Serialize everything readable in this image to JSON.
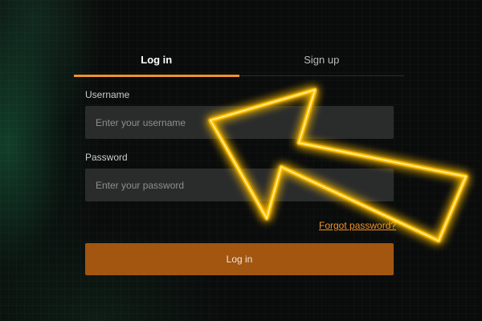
{
  "tabs": {
    "login_label": "Log in",
    "signup_label": "Sign up"
  },
  "form": {
    "username_label": "Username",
    "username_placeholder": "Enter your username",
    "username_value": "",
    "password_label": "Password",
    "password_placeholder": "Enter your password",
    "password_value": "",
    "forgot_label": "Forgot password?",
    "submit_label": "Log in"
  },
  "colors": {
    "accent": "#f0922a",
    "button": "#a25610",
    "arrow_glow": "#ffc400"
  },
  "icons": {
    "overlay": "pointer-arrow-icon"
  }
}
